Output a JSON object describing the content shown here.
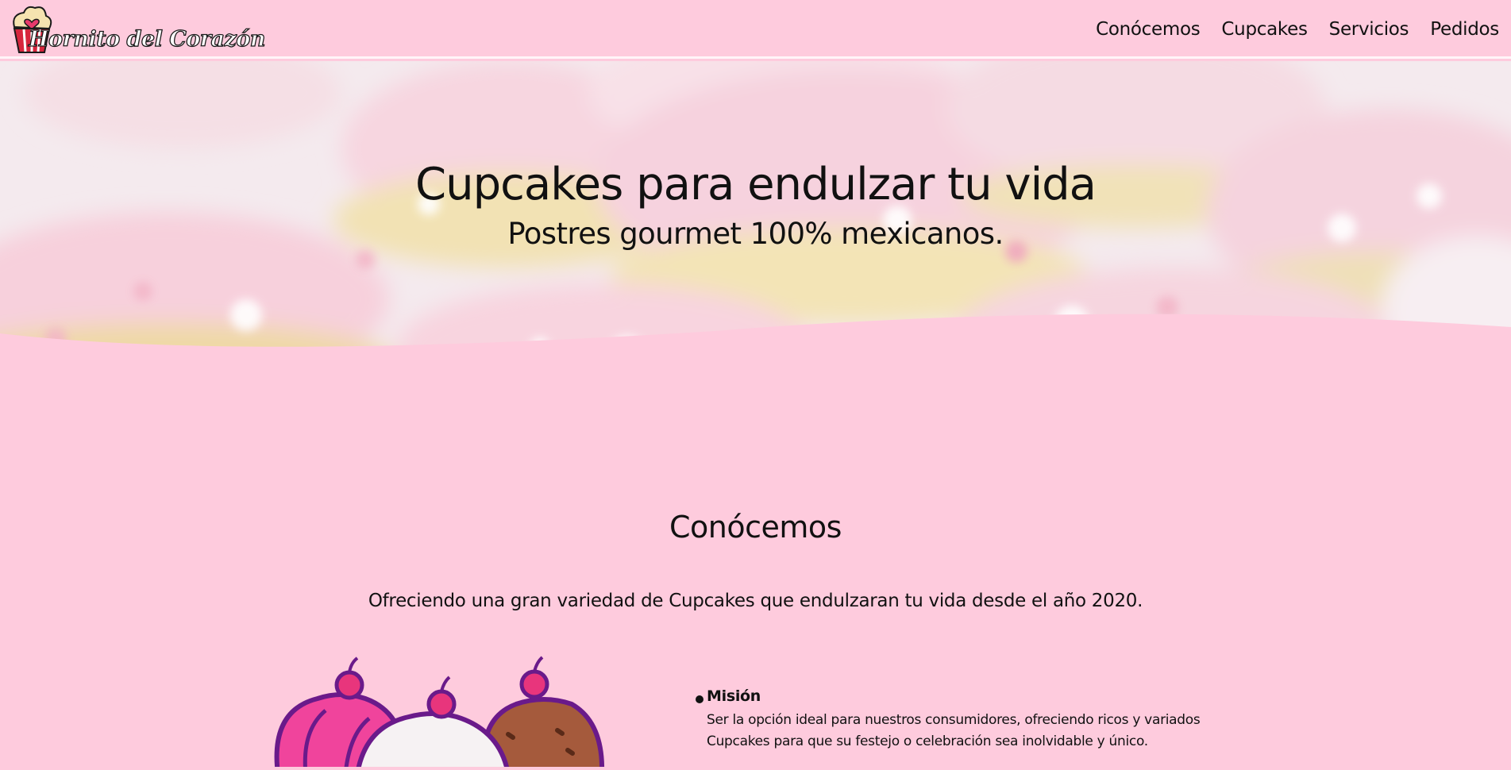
{
  "brand": {
    "name": "Hornito del Corazón",
    "logo_icon": "cupcake-heart-icon"
  },
  "nav": {
    "items": [
      "Conócemos",
      "Cupcakes",
      "Servicios",
      "Pedidos"
    ]
  },
  "hero": {
    "title": "Cupcakes para endulzar tu vida",
    "subtitle": "Postres gourmet 100% mexicanos."
  },
  "about": {
    "title": "Conócemos",
    "text": "Ofreciendo una gran variedad de Cupcakes que endulzaran tu vida desde el año 2020.",
    "illustration": "three-cupcakes-illustration",
    "items": [
      {
        "title": "Misión",
        "text": "Ser la opción ideal para nuestros consumidores, ofreciendo ricos y variados Cupcakes para que su festejo o celebración sea inolvidable y único."
      }
    ]
  },
  "colors": {
    "background": "#fecbdd",
    "frosting_pink": "#f0449c",
    "frosting_white": "#f6f2f3",
    "frosting_brown": "#a55a3c",
    "outline_purple": "#6a1a8a",
    "cherry": "#e8357c"
  }
}
